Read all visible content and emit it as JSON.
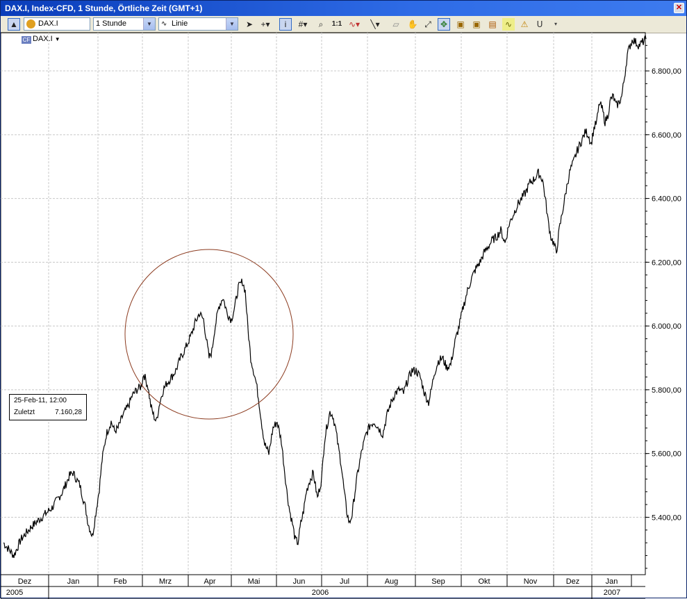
{
  "window": {
    "title": "DAX.I, Index-CFD, 1 Stunde, Örtliche Zeit (GMT+1)",
    "close_glyph": "✕"
  },
  "toolbar": {
    "symbol_value": "DAX.I",
    "interval_value": "1 Stunde",
    "chart_type_value": "Linie",
    "zoom_label": "1:1",
    "icons": [
      "up-arrow-icon",
      "symbol-icon",
      "cursor-arrow-icon",
      "crosshair-icon",
      "info-icon",
      "grid-icon",
      "zoom-icon",
      "indicator-icon",
      "line-tool-icon",
      "eraser-icon",
      "hand-icon",
      "expand-icon",
      "highlight-icon",
      "template-icon",
      "alert-icon",
      "magnet-icon"
    ]
  },
  "legend": {
    "symbol": "DAX.I",
    "icon_text": "CF"
  },
  "tooltip": {
    "date": "25-Feb-11, 12:00",
    "label": "Zuletzt",
    "value": "7.160,28"
  },
  "colors": {
    "line": "#000000",
    "circle": "#8b3a1e",
    "grid": "#c8c8c8",
    "title_bar": "#0a3dba"
  },
  "chart_data": {
    "type": "line",
    "series": [
      {
        "x": [
          0,
          15,
          25,
          40,
          55,
          70,
          85,
          95,
          100,
          110,
          118,
          122,
          128,
          132,
          138,
          142,
          148,
          155,
          160,
          165,
          172,
          180,
          185,
          192,
          198,
          202,
          208,
          212,
          216,
          220,
          225,
          230,
          235,
          242,
          248,
          255,
          262,
          270,
          276,
          282,
          288,
          292,
          296,
          300,
          304,
          310,
          316,
          322,
          328,
          333,
          338,
          344,
          348,
          352,
          356,
          360,
          364,
          368,
          372,
          376,
          382,
          388,
          394,
          400,
          404,
          408,
          412,
          416,
          420,
          424,
          428,
          432,
          436,
          440,
          446,
          452,
          458,
          462,
          466,
          470,
          474,
          478,
          482,
          486,
          490,
          494,
          498,
          502,
          506,
          510,
          516,
          522,
          528,
          534,
          540,
          546,
          552,
          558,
          564,
          570,
          576,
          582,
          588,
          594,
          600,
          606,
          612,
          616,
          620,
          626,
          632,
          638,
          644,
          650,
          656,
          662,
          668,
          674,
          680,
          686,
          692,
          698,
          704,
          710,
          716,
          722,
          728,
          734,
          740,
          746,
          752,
          758,
          764,
          770,
          776,
          780,
          784,
          788,
          792,
          796,
          800,
          804,
          808,
          812,
          816,
          820,
          826,
          832,
          838,
          842,
          846,
          850,
          854,
          858,
          862,
          866,
          870,
          874,
          878,
          882,
          886,
          890,
          894,
          898,
          902,
          906,
          910,
          915,
          920,
          925
        ],
        "values": [
          5320,
          5280,
          5330,
          5370,
          5400,
          5430,
          5480,
          5530,
          5540,
          5500,
          5430,
          5380,
          5340,
          5400,
          5490,
          5580,
          5660,
          5700,
          5670,
          5680,
          5720,
          5750,
          5780,
          5800,
          5810,
          5850,
          5810,
          5750,
          5720,
          5700,
          5760,
          5800,
          5820,
          5840,
          5860,
          5900,
          5930,
          5970,
          6010,
          6040,
          6020,
          5960,
          5900,
          5920,
          5990,
          6060,
          6090,
          6040,
          6020,
          6060,
          6120,
          6140,
          6110,
          5990,
          5900,
          5860,
          5820,
          5760,
          5690,
          5630,
          5600,
          5680,
          5700,
          5640,
          5560,
          5480,
          5420,
          5380,
          5330,
          5320,
          5380,
          5420,
          5480,
          5510,
          5540,
          5460,
          5520,
          5640,
          5690,
          5730,
          5720,
          5680,
          5620,
          5570,
          5490,
          5420,
          5380,
          5410,
          5480,
          5540,
          5610,
          5660,
          5690,
          5700,
          5680,
          5660,
          5720,
          5760,
          5790,
          5800,
          5790,
          5830,
          5860,
          5860,
          5840,
          5790,
          5760,
          5800,
          5850,
          5890,
          5900,
          5870,
          5880,
          5950,
          6000,
          6060,
          6110,
          6150,
          6180,
          6200,
          6230,
          6250,
          6270,
          6280,
          6300,
          6260,
          6320,
          6350,
          6380,
          6400,
          6420,
          6450,
          6460,
          6480,
          6460,
          6400,
          6330,
          6280,
          6260,
          6230,
          6300,
          6350,
          6400,
          6450,
          6490,
          6510,
          6550,
          6580,
          6610,
          6600,
          6570,
          6620,
          6640,
          6700,
          6680,
          6640,
          6660,
          6710,
          6720,
          6690,
          6700,
          6720,
          6780,
          6850,
          6880,
          6900,
          6890,
          6880,
          6890,
          6900
        ]
      }
    ],
    "x_tick_labels": [
      "Dez",
      "Jan",
      "Feb",
      "Mrz",
      "Apr",
      "Mai",
      "Jun",
      "Jul",
      "Aug",
      "Sep",
      "Okt",
      "Nov",
      "Dez",
      "Jan"
    ],
    "year_labels": [
      "2005",
      "2006",
      "2007"
    ],
    "y_ticks": [
      "5.400,00",
      "5.600,00",
      "5.800,00",
      "6.000,00",
      "6.200,00",
      "6.400,00",
      "6.600,00",
      "6.800,00"
    ],
    "y_tick_values": [
      5400,
      5600,
      5800,
      6000,
      6200,
      6400,
      6600,
      6800
    ],
    "ylim": [
      5220,
      6920
    ],
    "grid": true,
    "annotation": "circle"
  }
}
